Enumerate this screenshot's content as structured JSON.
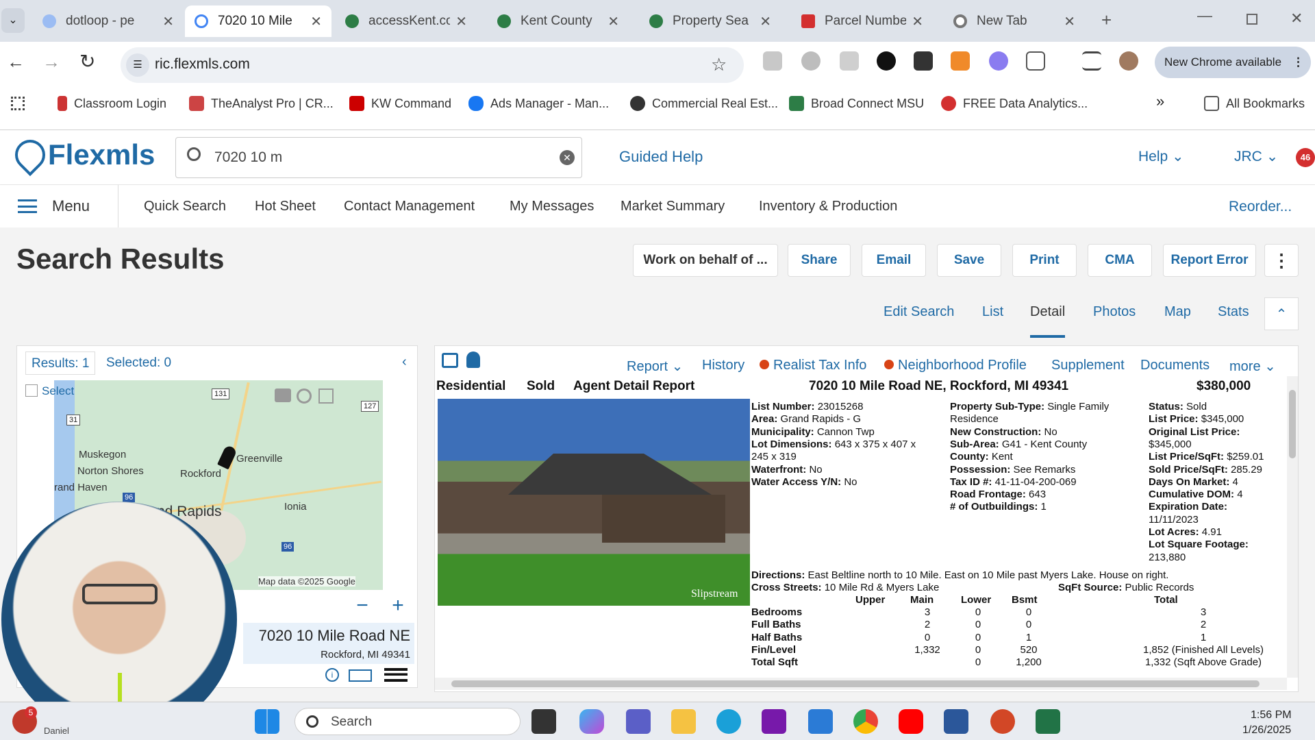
{
  "browser": {
    "tabs": [
      {
        "title": "dotloop - pe",
        "color": "#5b8def"
      },
      {
        "title": "7020 10 Mile",
        "color": "#4285f4"
      },
      {
        "title": "accessKent.co",
        "color": "#2d7d46"
      },
      {
        "title": "Kent County",
        "color": "#2d7d46"
      },
      {
        "title": "Property Sea",
        "color": "#2d7d46"
      },
      {
        "title": "Parcel Numbe",
        "color": "#d32f2f"
      },
      {
        "title": "New Tab",
        "color": "#777"
      }
    ],
    "url": "ric.flexmls.com",
    "new_chrome": "New Chrome available",
    "bookmarks": [
      "Classroom Login",
      "TheAnalyst Pro | CR...",
      "KW Command",
      "Ads Manager - Man...",
      "Commercial Real Est...",
      "Broad Connect MSU",
      "FREE Data Analytics..."
    ],
    "all_bookmarks": "All Bookmarks"
  },
  "flexmls": {
    "logo": "Flexmls",
    "search_value": "7020 10 m",
    "guided_help": "Guided Help",
    "help": "Help",
    "user": "JRC",
    "badge": "46",
    "menu": "Menu",
    "nav": [
      "Quick Search",
      "Hot Sheet",
      "Contact Management",
      "My Messages",
      "Market Summary",
      "Inventory & Production"
    ],
    "reorder": "Reorder..."
  },
  "page": {
    "title": "Search Results",
    "actions": [
      "Work on behalf of ...",
      "Share",
      "Email",
      "Save",
      "Print",
      "CMA",
      "Report Error"
    ],
    "views": [
      "Edit Search",
      "List",
      "Detail",
      "Photos",
      "Map",
      "Stats"
    ],
    "active_view": "Detail"
  },
  "left": {
    "results": "Results: 1",
    "selected": "Selected: 0",
    "select": "Select",
    "map_labels": {
      "muskegon": "Muskegon",
      "norton": "Norton Shores",
      "haven": "rand Haven",
      "greenville": "Greenville",
      "rockford": "Rockford",
      "rapids": "nd Rapids",
      "ionia": "Ionia",
      "r131": "131",
      "r127": "127",
      "r31": "31",
      "r96a": "96",
      "r96b": "96"
    },
    "map_credit": "Map data ©2025 Google",
    "address": "7020 10 Mile Road NE",
    "citystate": "Rockford, MI 49341"
  },
  "detail": {
    "tabs": [
      "Report",
      "History",
      "Realist Tax Info",
      "Neighborhood Profile",
      "Supplement",
      "Documents",
      "more"
    ],
    "header": {
      "type": "Residential",
      "status": "Sold",
      "report": "Agent Detail Report",
      "address": "7020 10 Mile Road NE, Rockford, MI 49341",
      "price": "$380,000"
    },
    "photo_credit": "Slipstream",
    "col1": [
      [
        "List Number:",
        "23015268"
      ],
      [
        "Area:",
        "Grand Rapids - G"
      ],
      [
        "Municipality:",
        "Cannon Twp"
      ],
      [
        "Lot Dimensions:",
        "643 x 375 x 407 x"
      ],
      [
        "",
        "245 x 319"
      ],
      [
        "Waterfront:",
        "No"
      ],
      [
        "Water Access Y/N:",
        "No"
      ]
    ],
    "col2": [
      [
        "Property Sub-Type:",
        "Single Family"
      ],
      [
        "",
        "Residence"
      ],
      [
        "New Construction:",
        "No"
      ],
      [
        "Sub-Area:",
        "G41 - Kent County"
      ],
      [
        "County:",
        "Kent"
      ],
      [
        "Possession:",
        "See Remarks"
      ],
      [
        "Tax ID #:",
        "41-11-04-200-069"
      ],
      [
        "Road Frontage:",
        "643"
      ],
      [
        "# of Outbuildings:",
        "1"
      ]
    ],
    "col3": [
      [
        "Status:",
        "Sold"
      ],
      [
        "List Price:",
        "$345,000"
      ],
      [
        "Original List Price:",
        ""
      ],
      [
        "",
        "$345,000"
      ],
      [
        "List Price/SqFt:",
        "$259.01"
      ],
      [
        "Sold Price/SqFt:",
        "285.29"
      ],
      [
        "Days On Market:",
        "4"
      ],
      [
        "Cumulative DOM:",
        "4"
      ],
      [
        "Expiration Date:",
        ""
      ],
      [
        "",
        "11/11/2023"
      ],
      [
        "Lot Acres:",
        "4.91"
      ],
      [
        "Lot Square Footage:",
        ""
      ],
      [
        "",
        "213,880"
      ]
    ],
    "directions": [
      "Directions:",
      "East Beltline north to 10 Mile. East on 10 Mile past Myers Lake. House on right."
    ],
    "cross": [
      "Cross Streets:",
      "10 Mile Rd & Myers Lake"
    ],
    "sqft_source": [
      "SqFt Source:",
      "Public Records"
    ],
    "table_headers": [
      "Upper",
      "Main",
      "Lower",
      "Bsmt",
      "Total"
    ],
    "table_rows": [
      {
        "label": "Bedrooms",
        "cells": [
          "",
          "3",
          "0",
          "0",
          "3"
        ]
      },
      {
        "label": "Full Baths",
        "cells": [
          "",
          "2",
          "0",
          "0",
          "2"
        ]
      },
      {
        "label": "Half Baths",
        "cells": [
          "",
          "0",
          "0",
          "1",
          "1"
        ]
      },
      {
        "label": "Fin/Level",
        "cells": [
          "",
          "1,332",
          "0",
          "520",
          "1,852 (Finished All Levels)"
        ]
      },
      {
        "label": "Total Sqft",
        "cells": [
          "",
          "",
          "0",
          "1,200",
          "1,332 (Sqft Above Grade)"
        ]
      }
    ]
  },
  "taskbar": {
    "search": "Search",
    "time": "1:56 PM",
    "date": "1/26/2025",
    "notif": "5",
    "user": "Daniel"
  }
}
